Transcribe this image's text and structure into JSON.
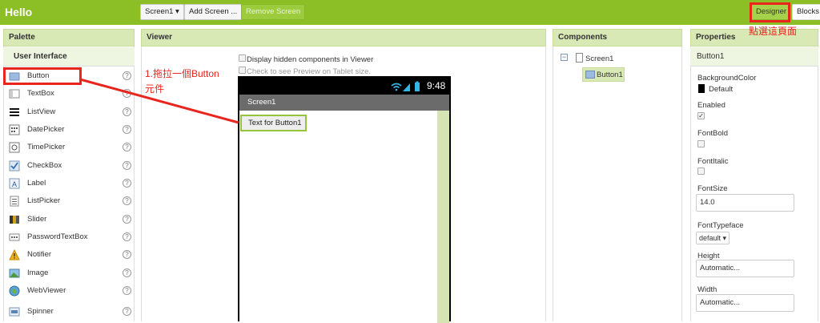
{
  "topbar": {
    "app_title": "Hello",
    "screen_select_label": "Screen1 ▾",
    "add_screen_label": "Add Screen ...",
    "remove_screen_label": "Remove Screen",
    "designer_label": "Designer",
    "blocks_label": "Blocks"
  },
  "palette": {
    "header": "Palette",
    "category": "User Interface",
    "help_glyph": "?",
    "items": [
      {
        "label": "Button",
        "icon": "button-icon"
      },
      {
        "label": "TextBox",
        "icon": "textbox-icon"
      },
      {
        "label": "ListView",
        "icon": "listview-icon"
      },
      {
        "label": "DatePicker",
        "icon": "datepicker-icon"
      },
      {
        "label": "TimePicker",
        "icon": "timepicker-icon"
      },
      {
        "label": "CheckBox",
        "icon": "checkbox-icon"
      },
      {
        "label": "Label",
        "icon": "label-icon"
      },
      {
        "label": "ListPicker",
        "icon": "listpicker-icon"
      },
      {
        "label": "Slider",
        "icon": "slider-icon"
      },
      {
        "label": "PasswordTextBox",
        "icon": "password-icon"
      },
      {
        "label": "Notifier",
        "icon": "notifier-icon"
      },
      {
        "label": "Image",
        "icon": "image-icon"
      },
      {
        "label": "WebViewer",
        "icon": "webviewer-icon"
      },
      {
        "label": "Spinner",
        "icon": "spinner-icon"
      }
    ]
  },
  "viewer": {
    "header": "Viewer",
    "display_hidden_label": "Display hidden components in Viewer",
    "tablet_preview_label": "Check to see Preview on Tablet size.",
    "phone": {
      "time": "9:48",
      "screen_title": "Screen1",
      "button_text": "Text for Button1"
    }
  },
  "components": {
    "header": "Components",
    "toggle_glyph": "−",
    "tree": [
      {
        "label": "Screen1"
      },
      {
        "label": "Button1"
      }
    ]
  },
  "properties": {
    "header": "Properties",
    "component_name": "Button1",
    "background_color_label": "BackgroundColor",
    "background_color_value": "Default",
    "enabled_label": "Enabled",
    "enabled_checked": true,
    "fontbold_label": "FontBold",
    "fontitalic_label": "FontItalic",
    "fontsize_label": "FontSize",
    "fontsize_value": "14.0",
    "fonttypeface_label": "FontTypeface",
    "fonttypeface_value": "default ▾",
    "height_label": "Height",
    "height_value": "Automatic...",
    "width_label": "Width",
    "width_value": "Automatic..."
  },
  "annotations": {
    "drag_line1": "1.拖拉一個Button",
    "drag_line2": "元件",
    "designer_note": "點選這頁面"
  },
  "colors": {
    "topbar": "#8cbe26",
    "panel_header": "#d9e9b6",
    "annotation_red": "#e8261e"
  }
}
